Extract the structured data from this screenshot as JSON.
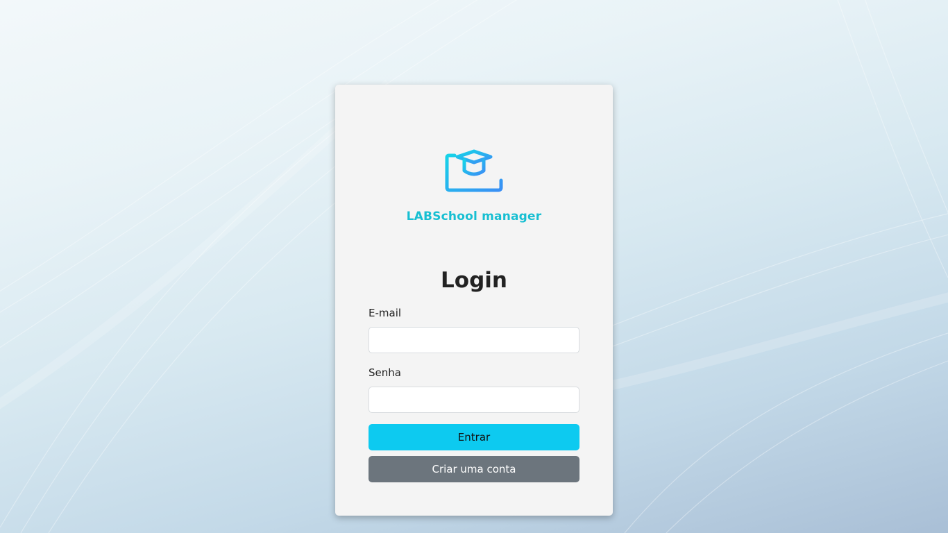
{
  "brand": {
    "name": "LABSchool manager",
    "icon": "graduation-cap-monitor-icon",
    "color": "#17bfd2"
  },
  "login": {
    "title": "Login",
    "email_label": "E-mail",
    "email_value": "",
    "password_label": "Senha",
    "password_value": "",
    "submit_label": "Entrar",
    "create_account_label": "Criar uma conta"
  },
  "colors": {
    "primary_button": "#0dcaf0",
    "secondary_button": "#6c757d",
    "card_background": "#f4f4f4"
  }
}
